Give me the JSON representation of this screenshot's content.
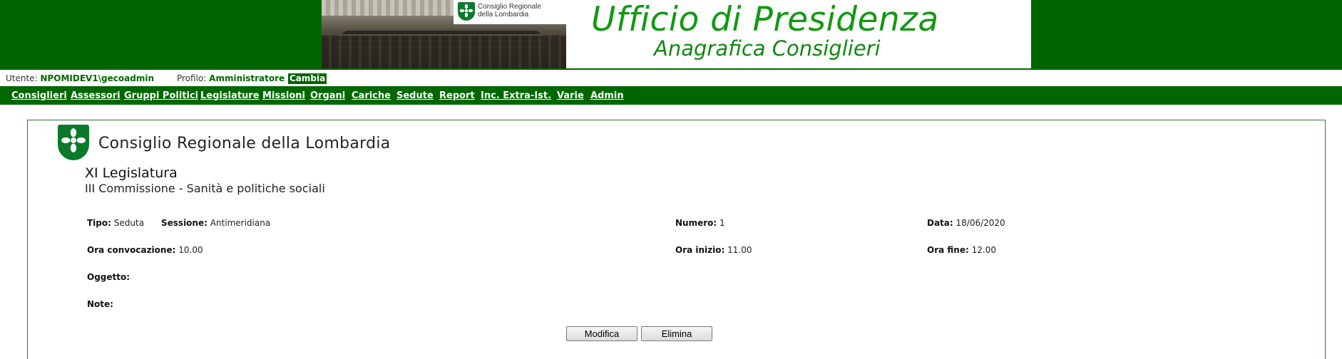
{
  "banner": {
    "logo_text_line1": "Consiglio Regionale",
    "logo_text_line2": "della Lombardia",
    "title": "Ufficio di Presidenza",
    "subtitle": "Anagrafica Consiglieri"
  },
  "userbar": {
    "user_label": "Utente:",
    "user_value": "NPOMIDEV1\\gecoadmin",
    "profile_label": "Profilo:",
    "profile_value": "Amministratore",
    "change_label": "Cambia"
  },
  "nav": {
    "items": [
      {
        "label": "Consiglieri"
      },
      {
        "label": "Assessori"
      },
      {
        "label": "Gruppi Politici"
      },
      {
        "label": "Legislature"
      },
      {
        "label": "Missioni"
      },
      {
        "label": "Organi"
      },
      {
        "label": "Cariche"
      },
      {
        "label": "Sedute"
      },
      {
        "label": "Report"
      },
      {
        "label": "Inc. Extra-Ist."
      },
      {
        "label": "Varie"
      },
      {
        "label": "Admin"
      }
    ]
  },
  "header": {
    "org_name": "Consiglio Regionale della Lombardia",
    "legislatura": "XI Legislatura",
    "commissione": "III Commissione - Sanità e politiche sociali"
  },
  "seduta": {
    "tipo_label": "Tipo:",
    "tipo_value": "Seduta",
    "sessione_label": "Sessione:",
    "sessione_value": "Antimeridiana",
    "numero_label": "Numero:",
    "numero_value": "1",
    "data_label": "Data:",
    "data_value": "18/06/2020",
    "ora_convocazione_label": "Ora convocazione:",
    "ora_convocazione_value": "10.00",
    "ora_inizio_label": "Ora inizio:",
    "ora_inizio_value": "11.00",
    "ora_fine_label": "Ora fine:",
    "ora_fine_value": "12.00",
    "oggetto_label": "Oggetto:",
    "oggetto_value": "",
    "note_label": "Note:",
    "note_value": ""
  },
  "actions": {
    "modifica_label": "Modifica",
    "elimina_label": "Elimina"
  },
  "icons": {
    "banner_logo": "lombardia-rose-icon",
    "header_logo": "lombardia-rose-icon"
  },
  "colors": {
    "brand_green": "#006600",
    "title_green": "#119911"
  }
}
